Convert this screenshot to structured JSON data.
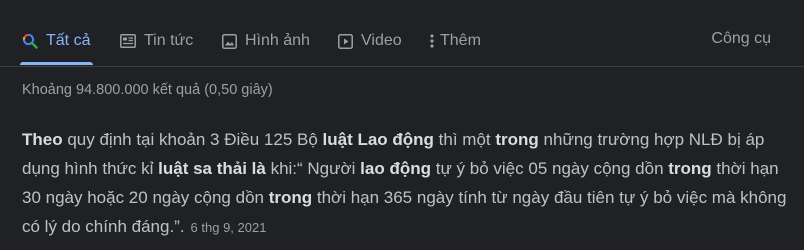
{
  "tabs": [
    {
      "label": "Tất cả",
      "icon": "search-icon"
    },
    {
      "label": "Tin tức",
      "icon": "news-icon"
    },
    {
      "label": "Hình ảnh",
      "icon": "image-icon"
    },
    {
      "label": "Video",
      "icon": "video-icon"
    },
    {
      "label": "Thêm",
      "icon": "more-vert-icon"
    }
  ],
  "tools_label": "Công cụ",
  "result_stats": "Khoảng 94.800.000 kết quả (0,50 giây)",
  "snippet": {
    "segments": [
      {
        "text": "Theo",
        "bold": true
      },
      {
        "text": " quy định tại khoản 3 Điều 125 Bộ ",
        "bold": false
      },
      {
        "text": "luật Lao động",
        "bold": true
      },
      {
        "text": " thì một ",
        "bold": false
      },
      {
        "text": "trong",
        "bold": true
      },
      {
        "text": " những trường hợp NLĐ bị áp dụng hình thức kỉ ",
        "bold": false
      },
      {
        "text": "luật sa thải là",
        "bold": true
      },
      {
        "text": " khi:“ Người ",
        "bold": false
      },
      {
        "text": "lao động",
        "bold": true
      },
      {
        "text": " tự ý bỏ việc 05 ngày cộng dồn ",
        "bold": false
      },
      {
        "text": "trong",
        "bold": true
      },
      {
        "text": " thời hạn 30 ngày hoặc 20 ngày cộng dồn ",
        "bold": false
      },
      {
        "text": "trong",
        "bold": true
      },
      {
        "text": " thời hạn 365 ngày tính từ ngày đầu tiên tự ý bỏ việc mà không có lý do chính đáng.”.",
        "bold": false
      }
    ],
    "date": "6 thg 9, 2021"
  },
  "colors": {
    "background": "#202124",
    "accent": "#8ab4f8",
    "text": "#bdc1c6",
    "muted": "#9aa0a6"
  }
}
